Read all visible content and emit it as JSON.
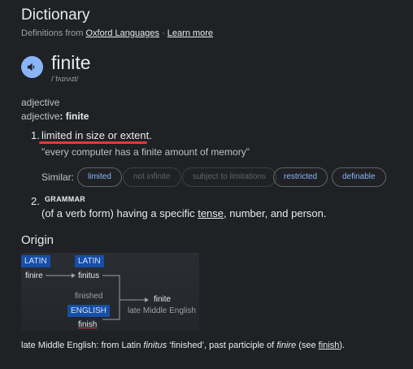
{
  "header": {
    "title": "Dictionary",
    "source_prefix": "Definitions from",
    "source_link": "Oxford Languages",
    "separator": "·",
    "learn_more": "Learn more"
  },
  "entry": {
    "word": "finite",
    "phonetic": "/ˈfʌɪnʌɪt/",
    "pos_general": "adjective",
    "pos_prefix": "adjective",
    "pos_word": "finite",
    "colon": ":"
  },
  "senses": [
    {
      "number": "1.",
      "definition": "limited in size or extent.",
      "example": "\"every computer has a finite amount of memory\"",
      "similar_label": "Similar:",
      "similar": [
        {
          "text": "limited",
          "active": true
        },
        {
          "text": "not infinite",
          "active": false
        },
        {
          "text": "subject to limitations",
          "active": false
        },
        {
          "text": "restricted",
          "active": true
        },
        {
          "text": "definable",
          "active": true
        }
      ]
    },
    {
      "number": "2.",
      "label": "GRAMMAR",
      "def_before": "(of a verb form) having a specific ",
      "def_link": "tense",
      "def_after": ", number, and person."
    }
  ],
  "origin": {
    "heading": "Origin",
    "diagram": {
      "lang1": "LATIN",
      "word1": "finire",
      "lang2": "LATIN",
      "word2": "finitus",
      "word3": "finished",
      "lang3": "ENGLISH",
      "word4": "finish",
      "result_word": "finite",
      "result_period": "late Middle English"
    },
    "text": {
      "p1": "late Middle English: from Latin ",
      "i1": "finitus",
      "p2": " ‘finished’, past participle of ",
      "i2": "finire",
      "p3": " (see ",
      "link": "finish",
      "p4": ")."
    }
  },
  "colors": {
    "background": "#202124",
    "accent": "#8ab4f8",
    "underline_red": "#e53935",
    "lang_tag": "#174ea6"
  }
}
